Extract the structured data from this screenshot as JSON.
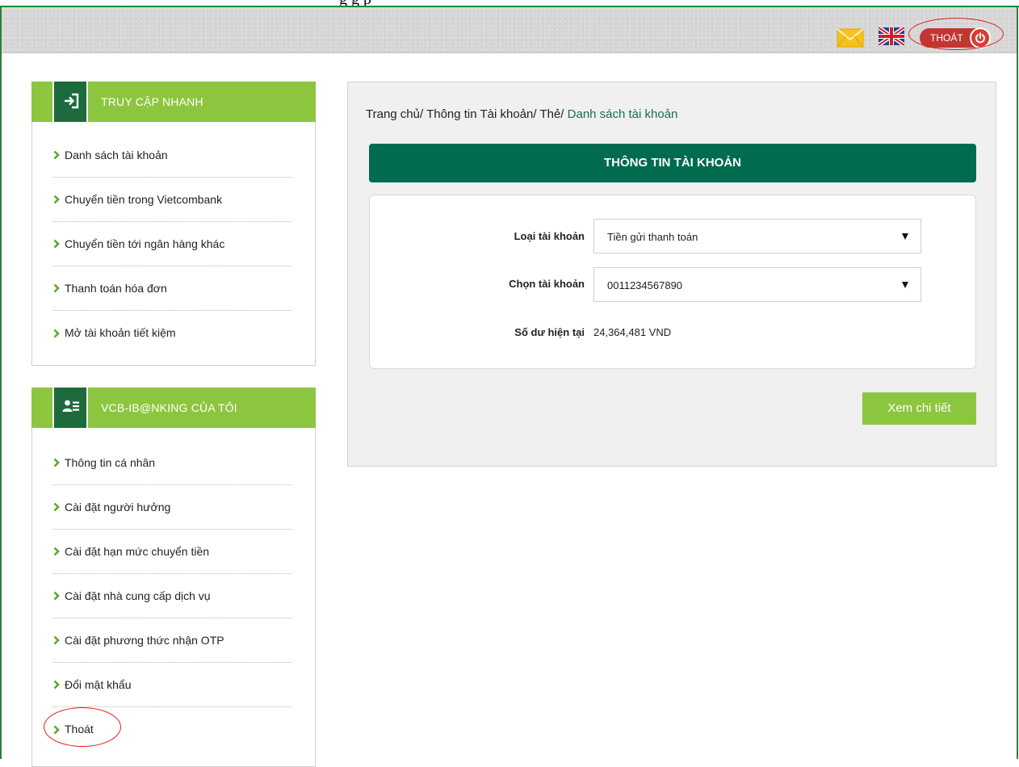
{
  "page_caption_fragment": "g  g p",
  "header": {
    "logout_label": "THOÁT"
  },
  "quick_access": {
    "title": "TRUY CẬP NHANH",
    "items": [
      "Danh sách tài khoản",
      "Chuyển tiền trong Vietcombank",
      "Chuyển tiền tới ngân hàng khác",
      "Thanh toán hóa đơn",
      "Mở tài khoản tiết kiệm"
    ]
  },
  "my_banking": {
    "title": "VCB-IB@NKING CỦA TÔI",
    "items": [
      "Thông tin cá nhân",
      "Cài đặt người hưởng",
      "Cài đặt hạn mức chuyển tiền",
      "Cài đặt nhà cung cấp dịch vụ",
      "Cài đặt phương thức nhận OTP",
      "Đổi mật khẩu",
      "Thoát"
    ]
  },
  "breadcrumb": {
    "home": "Trang chủ/",
    "level1": "Thông tin Tài khoản/",
    "level2": "Thẻ/",
    "current": "Danh sách tài khoản"
  },
  "account_info": {
    "title": "THÔNG TIN TÀI KHOẢN",
    "account_type_label": "Loại tài khoản",
    "account_type_value": "Tiền gửi thanh toán",
    "account_select_label": "Chọn tài khoản",
    "account_select_value": "0011234567890",
    "balance_label": "Số dư hiện tại",
    "balance_value": "24,364,481 VND",
    "detail_button": "Xem chi tiết"
  },
  "colors": {
    "brand_green": "#8cc63f",
    "dark_green": "#006b4e",
    "logout_red": "#c23631",
    "annotation_red": "#e21b1b"
  }
}
